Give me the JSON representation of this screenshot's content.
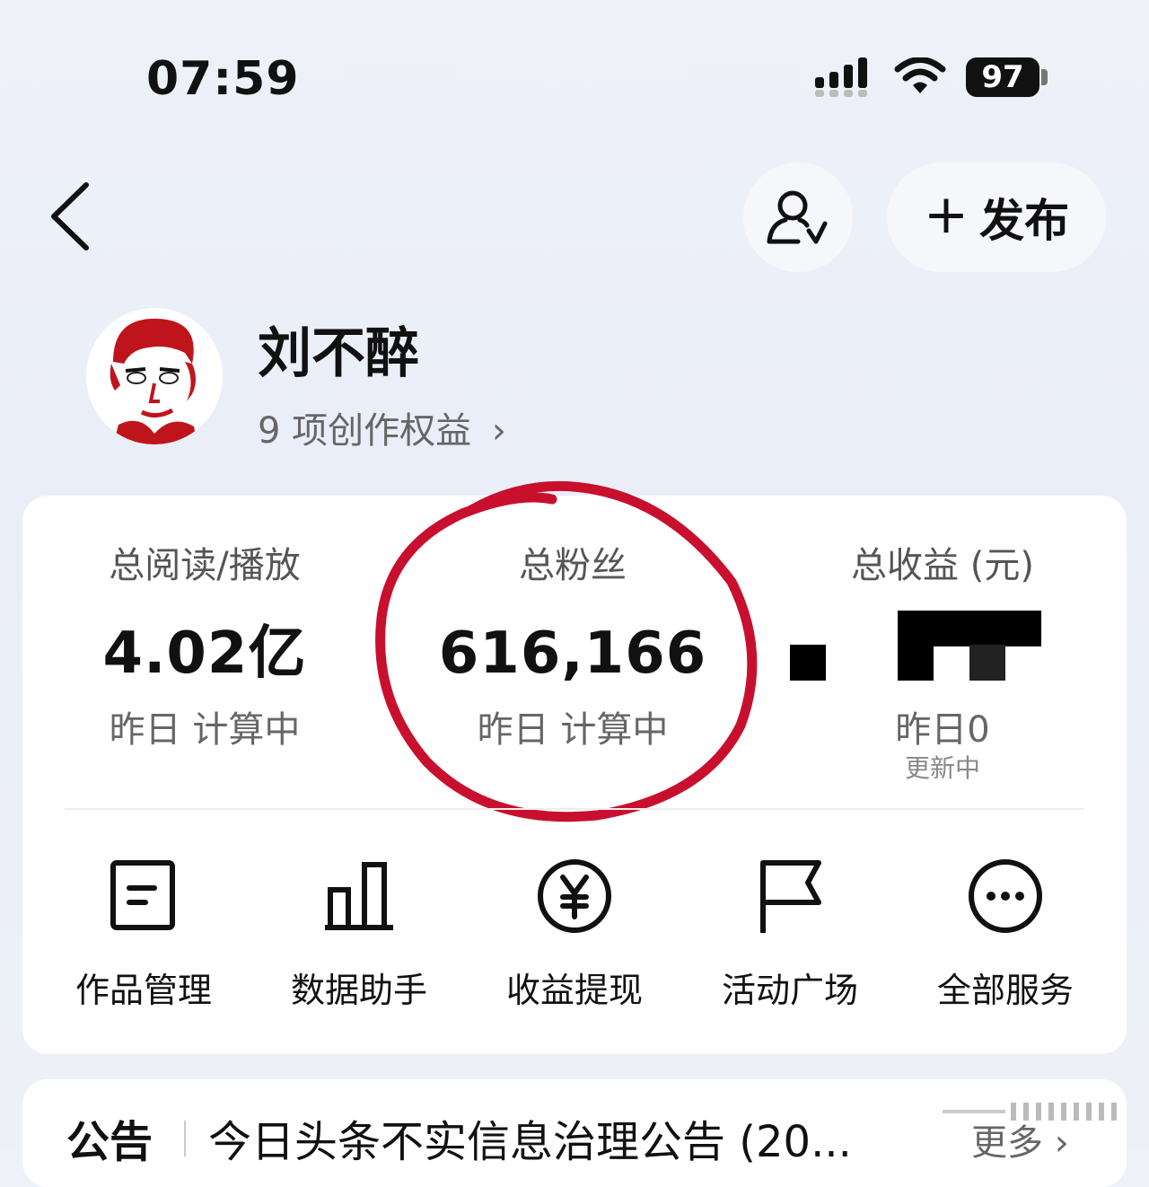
{
  "status_bar": {
    "time": "07:59",
    "battery": "97"
  },
  "header": {
    "publish_label": "发布"
  },
  "profile": {
    "name": "刘不醉",
    "rights": "9 项创作权益"
  },
  "stats": [
    {
      "label": "总阅读/播放",
      "value": "4.02亿",
      "sub": "昨日 计算中"
    },
    {
      "label": "总粉丝",
      "value": "616,166",
      "sub": "昨日 计算中"
    },
    {
      "label": "总收益 (元)",
      "value": "",
      "sub": "昨日0",
      "sub2": "更新中"
    }
  ],
  "services": [
    {
      "label": "作品管理",
      "icon": "document-icon"
    },
    {
      "label": "数据助手",
      "icon": "bar-chart-icon"
    },
    {
      "label": "收益提现",
      "icon": "yen-coin-icon"
    },
    {
      "label": "活动广场",
      "icon": "flag-icon"
    },
    {
      "label": "全部服务",
      "icon": "more-dots-icon"
    }
  ],
  "notice": {
    "title": "公告",
    "text": "今日头条不实信息治理公告 (20...",
    "more": "更多"
  },
  "colors": {
    "annotation_circle": "#c8102e",
    "avatar_red": "#c0141c"
  }
}
